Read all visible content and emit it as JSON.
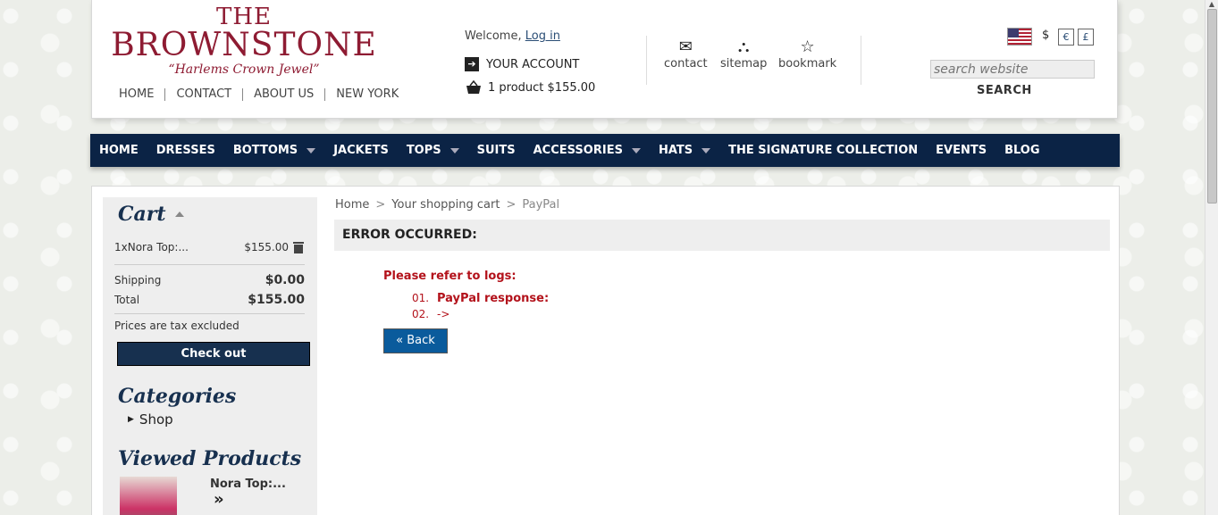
{
  "logo": {
    "line1": "THE",
    "line2": "BROWNSTONE",
    "tagline": "“Harlems Crown Jewel”"
  },
  "toplinks": [
    "HOME",
    "CONTACT",
    "ABOUT US",
    "NEW YORK"
  ],
  "welcome": {
    "text": "Welcome, ",
    "login": "Log in"
  },
  "account": "YOUR ACCOUNT",
  "cart_summary": "1 product $155.00",
  "quick_links": [
    {
      "label": "contact",
      "icon": "envelope-icon"
    },
    {
      "label": "sitemap",
      "icon": "sitemap-icon"
    },
    {
      "label": "bookmark",
      "icon": "star-icon"
    }
  ],
  "currency": {
    "selected": "$",
    "options": [
      "€",
      "£"
    ]
  },
  "search": {
    "placeholder": "search website",
    "button": "SEARCH"
  },
  "nav": [
    {
      "label": "HOME",
      "dropdown": false
    },
    {
      "label": "DRESSES",
      "dropdown": false
    },
    {
      "label": "BOTTOMS",
      "dropdown": true
    },
    {
      "label": "JACKETS",
      "dropdown": false
    },
    {
      "label": "TOPS",
      "dropdown": true
    },
    {
      "label": "SUITS",
      "dropdown": false
    },
    {
      "label": "ACCESSORIES",
      "dropdown": true
    },
    {
      "label": "HATS",
      "dropdown": true
    },
    {
      "label": "THE SIGNATURE COLLECTION",
      "dropdown": false
    },
    {
      "label": "EVENTS",
      "dropdown": false
    },
    {
      "label": "BLOG",
      "dropdown": false
    }
  ],
  "sidebar": {
    "cart_title": "Cart",
    "item": {
      "name": "1xNora Top:...",
      "price": "$155.00"
    },
    "shipping_label": "Shipping",
    "shipping_value": "$0.00",
    "total_label": "Total",
    "total_value": "$155.00",
    "tax_note": "Prices are tax excluded",
    "checkout": "Check out",
    "categories_title": "Categories",
    "category": "Shop",
    "viewed_title": "Viewed Products",
    "viewed_item": "Nora Top:...",
    "viewed_more": "»"
  },
  "breadcrumb": [
    "Home",
    "Your shopping cart",
    "PayPal"
  ],
  "error": {
    "title": "ERROR OCCURRED:",
    "refer": "Please refer to logs:",
    "lines": [
      {
        "num": "01.",
        "text": "PayPal response:"
      },
      {
        "num": "02.",
        "text": "->"
      }
    ],
    "back": "« Back"
  },
  "colors": {
    "nav_bg": "#0b2345",
    "brand": "#8e1b32",
    "error": "#b3121b",
    "back_btn": "#0a5b9c"
  }
}
